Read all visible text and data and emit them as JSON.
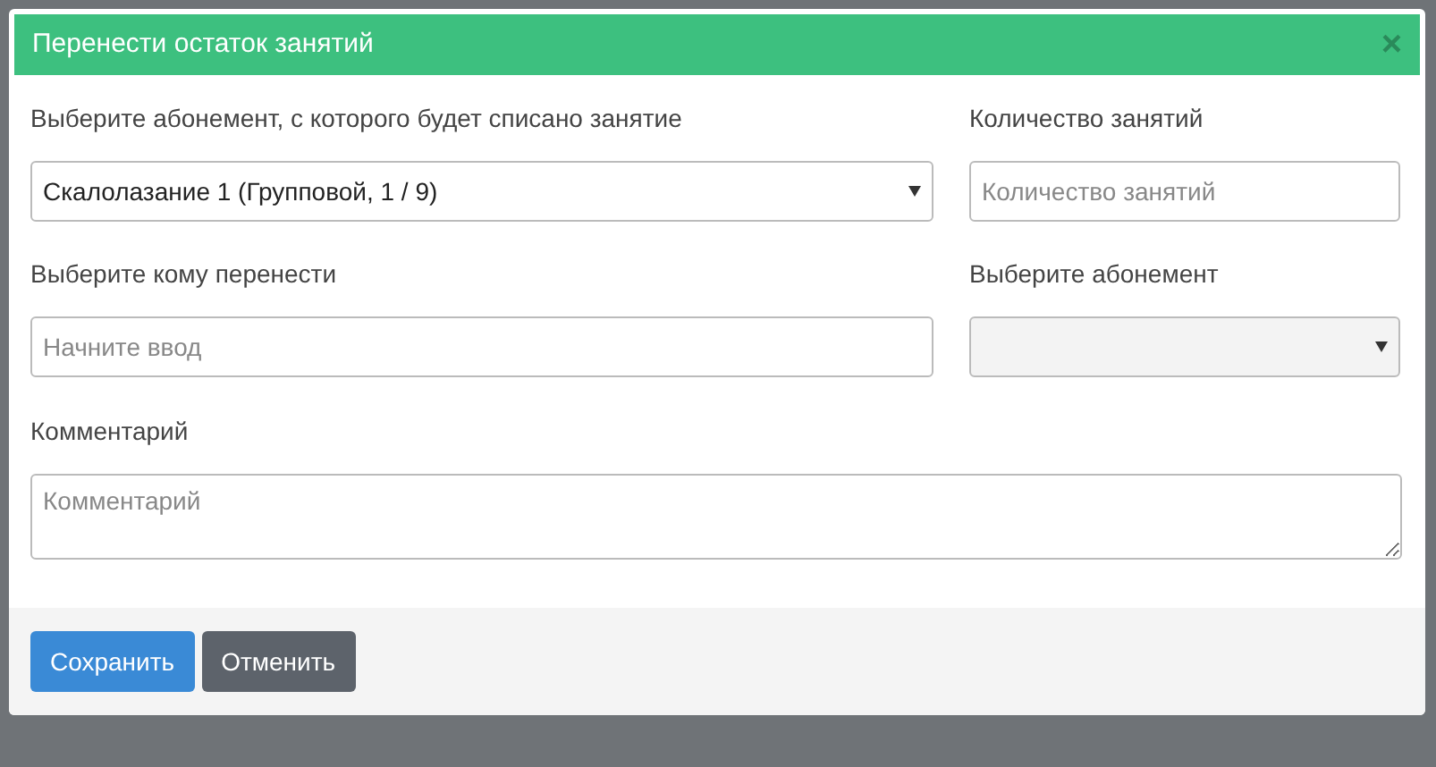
{
  "modal": {
    "title": "Перенести остаток занятий",
    "close": "×"
  },
  "fields": [
    {
      "kind": "select",
      "label": "Выберите абонемент, с которого будет списано занятие",
      "value": "Скалолазание 1 (Групповой, 1 / 9)"
    },
    {
      "kind": "input",
      "label": "Количество занятий",
      "placeholder": "Количество занятий"
    },
    {
      "kind": "input",
      "label": "Выберите кому перенести",
      "placeholder": "Начните ввод"
    },
    {
      "kind": "select",
      "label": "Выберите абонемент",
      "disabled": true
    },
    {
      "kind": "textarea",
      "label": "Комментарий",
      "placeholder": "Комментарий"
    }
  ],
  "buttons": [
    {
      "label": "Сохранить",
      "kind": "primary"
    },
    {
      "label": "Отменить",
      "kind": "secondary"
    }
  ]
}
